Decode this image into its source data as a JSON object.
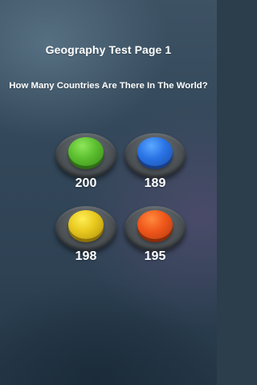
{
  "page": {
    "title": "Geography Test Page 1",
    "question": "How Many Countries Are There In The World?"
  },
  "answers": [
    {
      "label": "200",
      "color": "green",
      "hex": "#5cbf2f"
    },
    {
      "label": "189",
      "color": "blue",
      "hex": "#2a74e6"
    },
    {
      "label": "198",
      "color": "yellow",
      "hex": "#e8c81e"
    },
    {
      "label": "195",
      "color": "orange",
      "hex": "#f0571b"
    }
  ],
  "colors": {
    "background": "#2e4254",
    "text": "#ffffff",
    "button_base": "#4e5458"
  }
}
